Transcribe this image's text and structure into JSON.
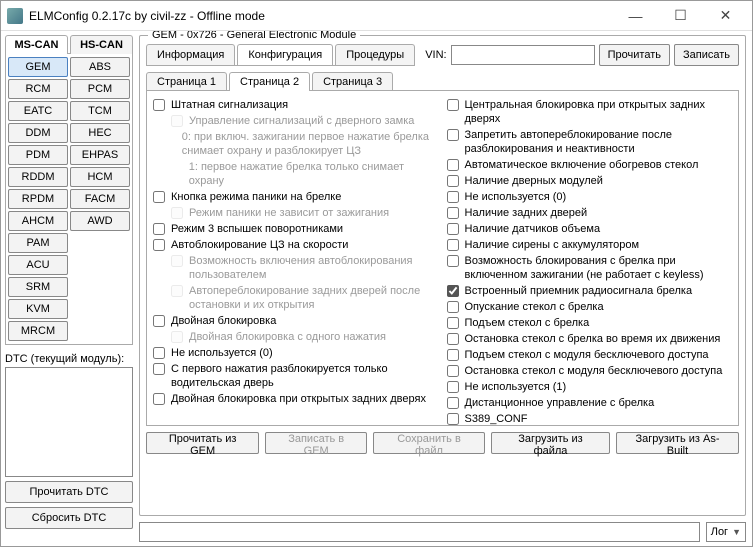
{
  "window": {
    "title": "ELMConfig 0.2.17c by civil-zz - Offline mode",
    "minimize": "—",
    "maximize": "☐",
    "close": "✕"
  },
  "bus_tabs": {
    "ms": "MS-CAN",
    "hs": "HS-CAN",
    "active": "ms"
  },
  "modules_ms": [
    "GEM",
    "RCM",
    "EATC",
    "DDM",
    "PDM",
    "RDDM",
    "RPDM",
    "AHCM",
    "PAM",
    "ACU",
    "SRM",
    "KVM",
    "MRCM"
  ],
  "modules_hs": [
    "ABS",
    "PCM",
    "TCM",
    "HEC",
    "EHPAS",
    "HCM",
    "FACM",
    "AWD"
  ],
  "module_active": "GEM",
  "dtc": {
    "label": "DTC (текущий модуль):",
    "read": "Прочитать DTC",
    "reset": "Сбросить DTC"
  },
  "gem": {
    "legend": "GEM - 0x726 - General Electronic Module",
    "tabs": {
      "info": "Информация",
      "conf": "Конфигурация",
      "proc": "Процедуры"
    },
    "vin_label": "VIN:",
    "vin_value": "",
    "read": "Прочитать",
    "write": "Записать",
    "pages": {
      "p1": "Страница 1",
      "p2": "Страница 2",
      "p3": "Страница 3"
    },
    "left_col": [
      {
        "checked": false,
        "enabled": true,
        "indent": 0,
        "text": "Штатная сигнализация"
      },
      {
        "checked": false,
        "enabled": false,
        "indent": 1,
        "text": "Управление сигнализаций с дверного замка"
      },
      {
        "checked": null,
        "enabled": false,
        "indent": 1,
        "text": "0: при включ. зажигании первое нажатие брелка снимает охрану и разблокирует ЦЗ"
      },
      {
        "checked": null,
        "enabled": false,
        "indent": 1,
        "text": "1: первое нажатие брелка только снимает охрану"
      },
      {
        "checked": false,
        "enabled": true,
        "indent": 0,
        "text": "Кнопка режима паники на брелке"
      },
      {
        "checked": false,
        "enabled": false,
        "indent": 1,
        "text": "Режим паники не зависит от зажигания"
      },
      {
        "checked": false,
        "enabled": true,
        "indent": 0,
        "text": "Режим 3 вспышек поворотниками"
      },
      {
        "checked": false,
        "enabled": true,
        "indent": 0,
        "text": "Автоблокирование ЦЗ на скорости"
      },
      {
        "checked": false,
        "enabled": false,
        "indent": 1,
        "text": "Возможность включения автоблокирования пользователем"
      },
      {
        "checked": false,
        "enabled": false,
        "indent": 1,
        "text": "Автопереблокирование задних дверей после остановки и их открытия"
      },
      {
        "checked": false,
        "enabled": true,
        "indent": 0,
        "text": "Двойная блокировка"
      },
      {
        "checked": false,
        "enabled": false,
        "indent": 1,
        "text": "Двойная блокировка с одного нажатия"
      },
      {
        "checked": false,
        "enabled": true,
        "indent": 0,
        "text": "Не используется (0)"
      },
      {
        "checked": false,
        "enabled": true,
        "indent": 0,
        "text": "С первого нажатия разблокируется только водительская дверь"
      },
      {
        "checked": false,
        "enabled": true,
        "indent": 0,
        "text": "Двойная блокировка при открытых задних дверях"
      }
    ],
    "right_col": [
      {
        "checked": false,
        "enabled": true,
        "text": "Центральная блокировка при открытых задних дверях"
      },
      {
        "checked": false,
        "enabled": true,
        "text": "Запретить автопереблокирование после разблокирования и неактивности"
      },
      {
        "checked": false,
        "enabled": true,
        "text": "Автоматическое включение обогревов стекол"
      },
      {
        "checked": false,
        "enabled": true,
        "text": "Наличие дверных модулей"
      },
      {
        "checked": false,
        "enabled": true,
        "text": "Не используется (0)"
      },
      {
        "checked": false,
        "enabled": true,
        "text": "Наличие задних дверей"
      },
      {
        "checked": false,
        "enabled": true,
        "text": "Наличие датчиков объема"
      },
      {
        "checked": false,
        "enabled": true,
        "text": "Наличие сирены с аккумулятором"
      },
      {
        "checked": false,
        "enabled": true,
        "text": "Возможность блокирования с брелка при включенном зажигании (не работает с keyless)"
      },
      {
        "checked": true,
        "enabled": true,
        "text": "Встроенный приемник радиосигнала брелка"
      },
      {
        "checked": false,
        "enabled": true,
        "text": "Опускание стекол с брелка"
      },
      {
        "checked": false,
        "enabled": true,
        "text": "Подъем стекол с брелка"
      },
      {
        "checked": false,
        "enabled": true,
        "text": "Остановка стекол с брелка во время их движения"
      },
      {
        "checked": false,
        "enabled": true,
        "text": "Подъем стекол с модуля бесключевого доступа"
      },
      {
        "checked": false,
        "enabled": true,
        "text": "Остановка стекол с модуля бесключевого доступа"
      },
      {
        "checked": false,
        "enabled": true,
        "text": "Не используется (1)"
      },
      {
        "checked": false,
        "enabled": true,
        "text": "Дистанционное управление с брелка"
      },
      {
        "checked": false,
        "enabled": true,
        "text": "S389_CONF"
      }
    ],
    "bottom": {
      "read_gem": "Прочитать из GEM",
      "write_gem": "Записать в GEM",
      "save_file": "Сохранить в файл",
      "load_file": "Загрузить из файла",
      "load_asbuilt": "Загрузить из As-Built"
    }
  },
  "footer": {
    "combo": "Лог",
    "chev": "▼"
  }
}
